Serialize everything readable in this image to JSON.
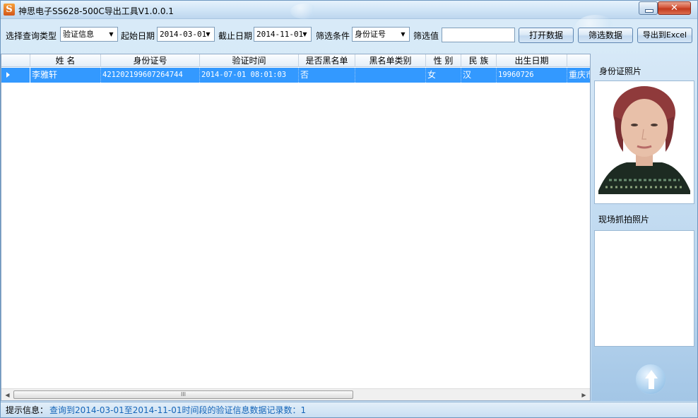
{
  "window": {
    "title": "神思电子SS628-500C导出工具V1.0.0.1",
    "icon": "ss-logo-icon",
    "close_glyph": "✕"
  },
  "toolbar": {
    "query_type_label": "选择查询类型",
    "query_type_value": "验证信息",
    "start_date_label": "起始日期",
    "start_date_value": "2014-03-01",
    "end_date_label": "截止日期",
    "end_date_value": "2014-11-01",
    "filter_condition_label": "筛选条件",
    "filter_condition_value": "身份证号",
    "filter_value_label": "筛选值",
    "filter_value": "",
    "open_data_label": "打开数据",
    "filter_data_label": "筛选数据",
    "export_excel_label": "导出到Excel"
  },
  "grid": {
    "columns": [
      "姓  名",
      "身份证号",
      "验证时间",
      "是否黑名单",
      "黑名单类别",
      "性  别",
      "民 族",
      "出生日期"
    ],
    "rows": [
      {
        "name": "李雅轩",
        "id_number": "421202199607264744",
        "verify_time": "2014-07-01 08:01:03",
        "blacklisted": "否",
        "blacklist_type": "",
        "gender": "女",
        "ethnicity": "汉",
        "birth_date": "19960726",
        "address": "重庆市"
      }
    ],
    "scroll_thumb_glyph": "III"
  },
  "right_panel": {
    "id_photo_label": "身份证照片",
    "live_photo_label": "现场抓拍照片"
  },
  "status": {
    "prefix": "提示信息：",
    "message": "查询到2014-03-01至2014-11-01时间段的验证信息数据记录数：1"
  },
  "colors": {
    "selection": "#3399ff",
    "status_text": "#1565b8"
  }
}
